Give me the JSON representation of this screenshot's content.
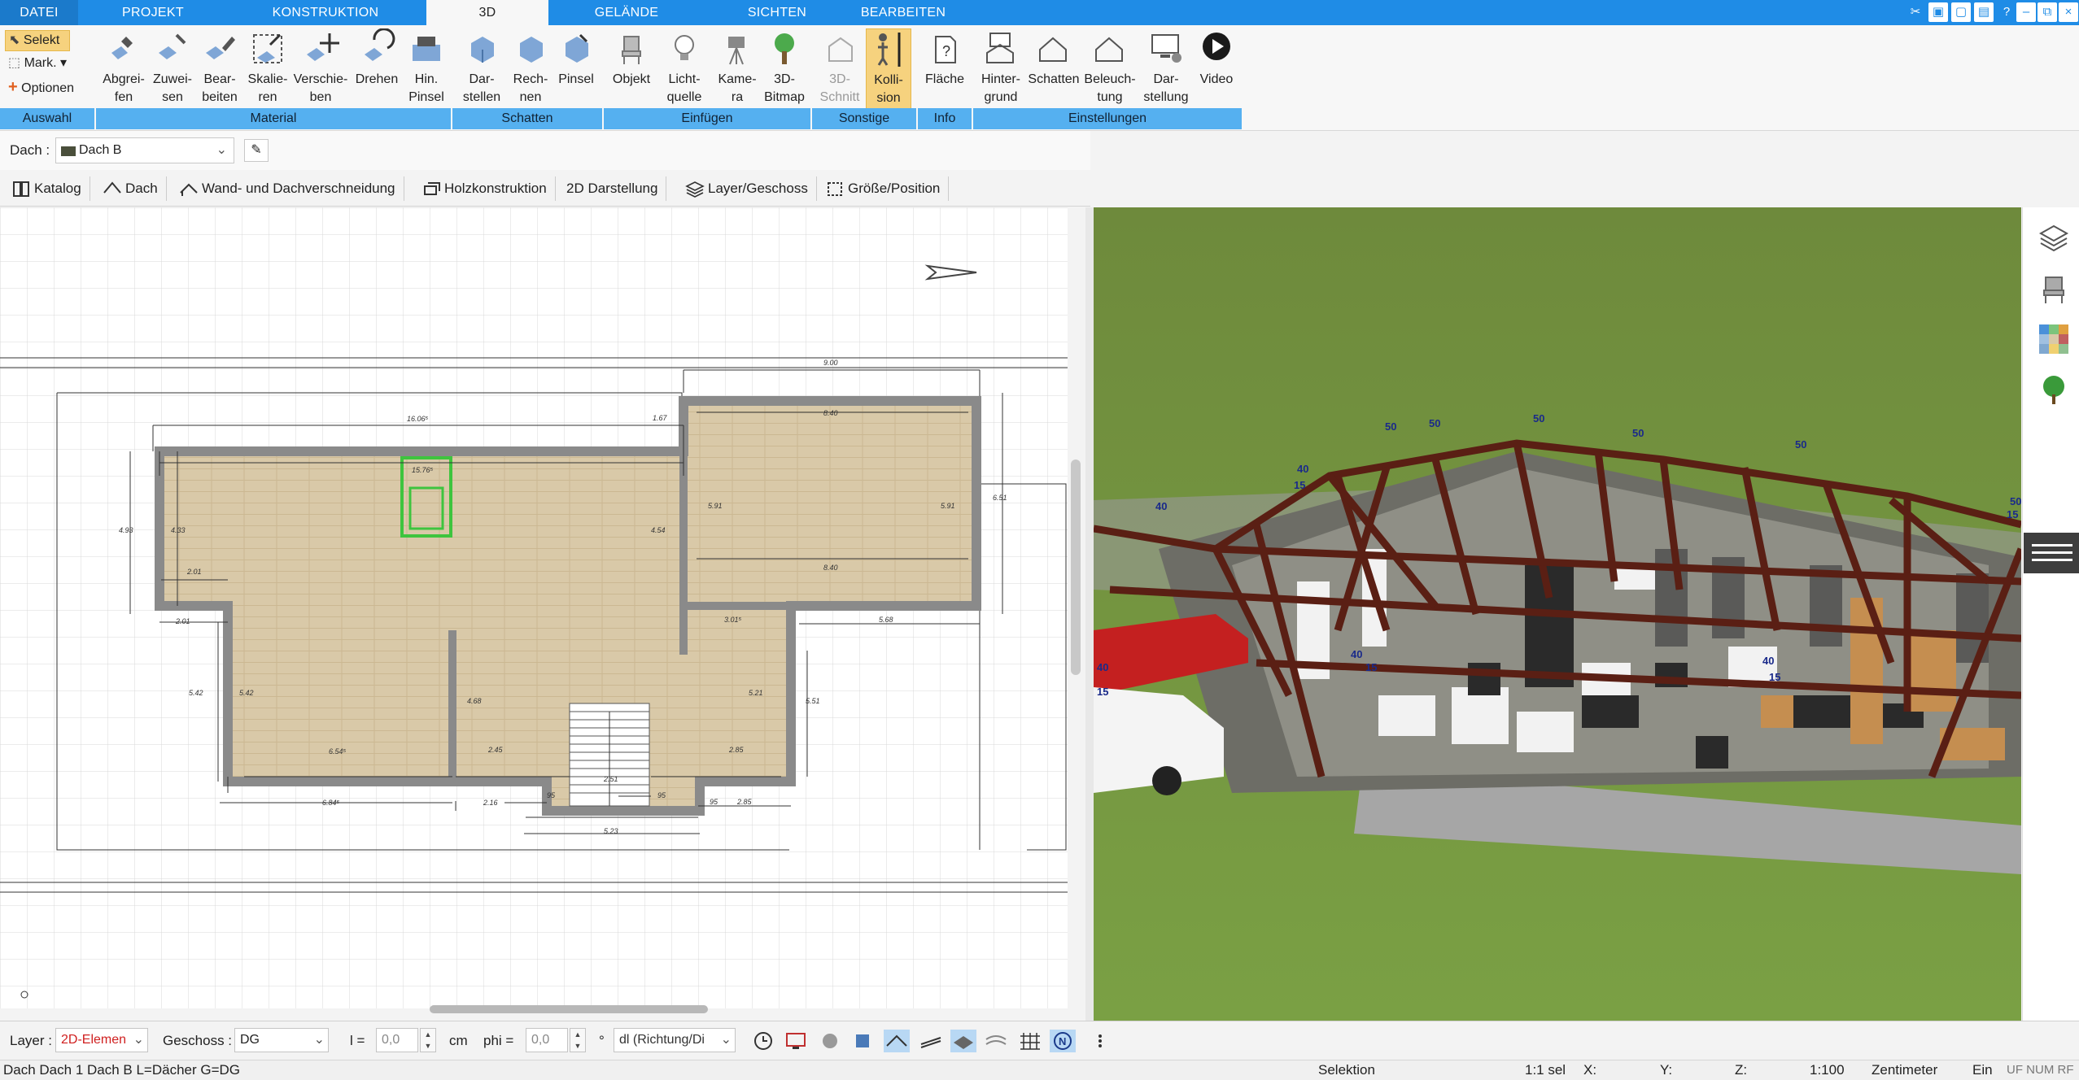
{
  "menu": {
    "tabs": [
      "DATEI",
      "PROJEKT",
      "KONSTRUKTION",
      "3D",
      "GELÄNDE",
      "SICHTEN",
      "BEARBEITEN"
    ],
    "active_tab": "3D"
  },
  "ribbon": {
    "auswahl": {
      "selekt": "Selekt",
      "mark": "Mark.",
      "optionen": "Optionen",
      "group": "Auswahl"
    },
    "material": {
      "buttons": [
        "Abgrei-\nfen",
        "Zuwei-\nsen",
        "Bear-\nbeiten",
        "Skalie-\nren",
        "Verschie-\nben",
        "Drehen",
        "Hin.\nPinsel"
      ],
      "group": "Material"
    },
    "schatten": {
      "buttons": [
        "Dar-\nstellen",
        "Rech-\nnen",
        "Pinsel"
      ],
      "group": "Schatten"
    },
    "einfuegen": {
      "buttons": [
        "Objekt",
        "Licht-\nquelle",
        "Kame-\nra",
        "3D-\nBitmap"
      ],
      "group": "Einfügen"
    },
    "sonstige": {
      "buttons": [
        "3D-\nSchnitt",
        "Kolli-\nsion"
      ],
      "group": "Sonstige"
    },
    "info": {
      "buttons": [
        "Fläche"
      ],
      "group": "Info"
    },
    "einstellungen": {
      "buttons": [
        "Hinter-\ngrund",
        "Schatten",
        "Beleuch-\ntung",
        "Dar-\nstellung",
        "Video"
      ],
      "group": "Einstellungen"
    }
  },
  "dach_row": {
    "label": "Dach :",
    "value": "Dach B"
  },
  "toolbar2": [
    "Katalog",
    "Dach",
    "Wand- und Dachverschneidung",
    "Holzkonstruktion",
    "2D Darstellung",
    "Layer/Geschoss",
    "Größe/Position"
  ],
  "plan": {
    "dimensions": [
      "9.00",
      "16.06⁵",
      "8.40",
      "8.40",
      "4.93",
      "4.33",
      "2.01",
      "2.01",
      "5.91",
      "5.91",
      "6.51",
      "4.54",
      "15.76⁵",
      "3.01⁵",
      "5.68",
      "5.42",
      "5.42",
      "4.68",
      "5.21",
      "5.51",
      "6.54⁵",
      "2.45",
      "2.85",
      "2.51",
      "6.84⁵",
      "2.16",
      "95",
      "95",
      "95",
      "2.85",
      "5.23",
      "1.67"
    ]
  },
  "view3d": {
    "labels": [
      "50",
      "50",
      "50",
      "50",
      "50",
      "40",
      "40",
      "40",
      "40",
      "40",
      "15",
      "15",
      "15",
      "15",
      "50",
      "15"
    ]
  },
  "bottombar": {
    "layer_label": "Layer :",
    "layer_value": "2D-Elemen",
    "geschoss_label": "Geschoss :",
    "geschoss_value": "DG",
    "l_label": "l =",
    "l_value": "0,0",
    "l_unit": "cm",
    "phi_label": "phi =",
    "phi_value": "0,0",
    "phi_unit": "°",
    "mode_value": "dl (Richtung/Di"
  },
  "statusbar": {
    "left": "Dach Dach 1 Dach B L=Dächer G=DG",
    "selektion": "Selektion",
    "sel": "1:1 sel",
    "x": "X:",
    "y": "Y:",
    "z": "Z:",
    "scale": "1:100",
    "unit": "Zentimeter",
    "ein": "Ein",
    "flags": "UF NUM RF"
  },
  "colors": {
    "menu_blue": "#1f8ce6",
    "group_blue": "#55b0f0",
    "active_yellow": "#f6d27e"
  }
}
